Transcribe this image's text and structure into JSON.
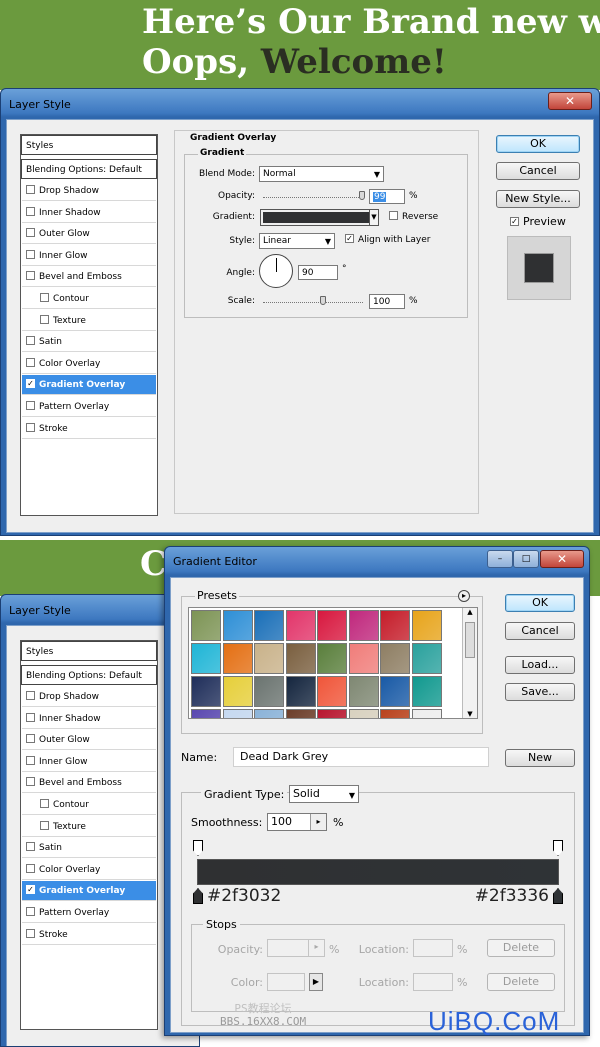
{
  "banner": {
    "line1": "Here’s Our Brand new wo",
    "line2_prefix": "Oops, ",
    "line2_dark": "Welcome!",
    "peek_char": "C"
  },
  "layer_style_1": {
    "title": "Layer Style",
    "close_label": "✕",
    "styles_header": "Styles",
    "blending_label": "Blending Options: Default",
    "items": [
      {
        "label": "Drop Shadow",
        "checked": false,
        "indent": false
      },
      {
        "label": "Inner Shadow",
        "checked": false,
        "indent": false
      },
      {
        "label": "Outer Glow",
        "checked": false,
        "indent": false
      },
      {
        "label": "Inner Glow",
        "checked": false,
        "indent": false
      },
      {
        "label": "Bevel and Emboss",
        "checked": false,
        "indent": false
      },
      {
        "label": "Contour",
        "checked": false,
        "indent": true
      },
      {
        "label": "Texture",
        "checked": false,
        "indent": true
      },
      {
        "label": "Satin",
        "checked": false,
        "indent": false
      },
      {
        "label": "Color Overlay",
        "checked": false,
        "indent": false
      },
      {
        "label": "Gradient Overlay",
        "checked": true,
        "indent": false,
        "selected": true
      },
      {
        "label": "Pattern Overlay",
        "checked": false,
        "indent": false
      },
      {
        "label": "Stroke",
        "checked": false,
        "indent": false
      }
    ],
    "section_title": "Gradient Overlay",
    "group_title": "Gradient",
    "blend_mode_label": "Blend Mode:",
    "blend_mode_value": "Normal",
    "opacity_label": "Opacity:",
    "opacity_value": "99",
    "opacity_fraction": 0.99,
    "gradient_label": "Gradient:",
    "gradient_color": "#2f3032",
    "reverse_label": "Reverse",
    "reverse_checked": false,
    "style_label": "Style:",
    "style_value": "Linear",
    "align_label": "Align with Layer",
    "align_checked": true,
    "angle_label": "Angle:",
    "angle_value": "90",
    "degree": "°",
    "scale_label": "Scale:",
    "scale_value": "100",
    "scale_fraction": 0.6,
    "percent": "%",
    "ok_label": "OK",
    "cancel_label": "Cancel",
    "new_style_label": "New Style...",
    "preview_label": "Preview",
    "preview_checked": true
  },
  "layer_style_2": {
    "title": "Layer Style",
    "styles_header": "Styles",
    "blending_label": "Blending Options: Default",
    "items": [
      {
        "label": "Drop Shadow",
        "checked": false,
        "indent": false
      },
      {
        "label": "Inner Shadow",
        "checked": false,
        "indent": false
      },
      {
        "label": "Outer Glow",
        "checked": false,
        "indent": false
      },
      {
        "label": "Inner Glow",
        "checked": false,
        "indent": false
      },
      {
        "label": "Bevel and Emboss",
        "checked": false,
        "indent": false
      },
      {
        "label": "Contour",
        "checked": false,
        "indent": true
      },
      {
        "label": "Texture",
        "checked": false,
        "indent": true
      },
      {
        "label": "Satin",
        "checked": false,
        "indent": false
      },
      {
        "label": "Color Overlay",
        "checked": false,
        "indent": false
      },
      {
        "label": "Gradient Overlay",
        "checked": true,
        "indent": false,
        "selected": true
      },
      {
        "label": "Pattern Overlay",
        "checked": false,
        "indent": false
      },
      {
        "label": "Stroke",
        "checked": false,
        "indent": false
      }
    ]
  },
  "gradient_editor": {
    "title": "Gradient Editor",
    "min_label": "–",
    "max_label": "□",
    "close_label": "✕",
    "presets_label": "Presets",
    "presets_menu_icon": "▸",
    "preset_colors": [
      [
        "#7d9455",
        "#2e8fd6",
        "#1a6fb8",
        "#e2356a",
        "#d8183f",
        "#c0287d",
        "#c51d2a",
        "#e7a41b"
      ],
      [
        "#1fb5d6",
        "#e46f13",
        "#c9b28a",
        "#7a5f3f",
        "#5a7f3c",
        "#f07d7a",
        "#8e7e63",
        "#2aa19d"
      ],
      [
        "#1f2e5a",
        "#e6cf3a",
        "#6b7470",
        "#15263f",
        "#f0563a",
        "#7f8873",
        "#195aa6",
        "#11998f"
      ],
      [
        "#5a49b0",
        "#c5d8ef",
        "#8bb3d8",
        "#6c3e2a",
        "#b8162f",
        "#d8d1bf",
        "#b9431d",
        "#eeeeee"
      ]
    ],
    "ok_label": "OK",
    "cancel_label": "Cancel",
    "load_label": "Load...",
    "save_label": "Save...",
    "name_label": "Name:",
    "name_value": "Dead Dark Grey",
    "new_label": "New",
    "type_label": "Gradient Type:",
    "type_value": "Solid",
    "smoothness_label": "Smoothness:",
    "smoothness_value": "100",
    "percent": "%",
    "stop_left_hex": "#2f3032",
    "stop_right_hex": "#2f3336",
    "stops_label": "Stops",
    "opacity_label": "Opacity:",
    "color_label": "Color:",
    "location_label": "Location:",
    "delete_label": "Delete"
  },
  "watermark": {
    "logo": "UiBQ.CoM",
    "site_line1": "PS教程论坛",
    "site_line2": "BBS.16XX8.COM"
  }
}
